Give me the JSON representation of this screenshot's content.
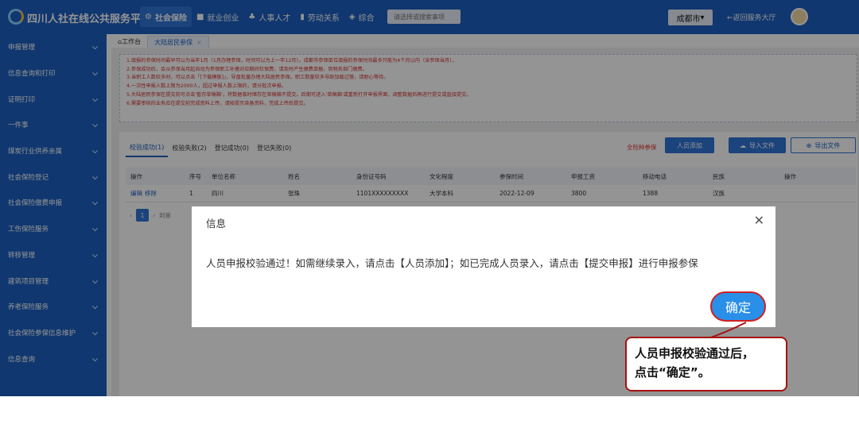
{
  "header": {
    "app_title": "四川人社在线公共服务平台",
    "nav": [
      {
        "icon": "shield-person-icon",
        "label": "社会保险",
        "glyph": "⚙"
      },
      {
        "icon": "briefcase-icon",
        "label": "就业创业",
        "glyph": "■"
      },
      {
        "icon": "people-icon",
        "label": "人事人才",
        "glyph": "♣"
      },
      {
        "icon": "document-icon",
        "label": "劳动关系",
        "glyph": "▮"
      },
      {
        "icon": "layers-icon",
        "label": "综合",
        "glyph": "◈"
      }
    ],
    "search_placeholder": "请选择或搜索事项",
    "city": "成都市",
    "city_caret": "▾",
    "back_label": "←返回服务大厅"
  },
  "sidebar": {
    "items": [
      {
        "label": "申报管理"
      },
      {
        "label": "信息查询和打印"
      },
      {
        "label": "证明打印"
      },
      {
        "label": "一件事"
      },
      {
        "label": "煤炭行业供养亲属"
      },
      {
        "label": "社会保险登记"
      },
      {
        "label": "社会保险缴费申报"
      },
      {
        "label": "工伤保险服务"
      },
      {
        "label": "转移管理"
      },
      {
        "label": "建筑项目管理"
      },
      {
        "label": "养老保险服务"
      },
      {
        "label": "社会保险参保信息维护"
      },
      {
        "label": "信息查询"
      }
    ]
  },
  "tabs": {
    "home_icon": "⌂",
    "home": "工作台",
    "active": "大陆居民参保",
    "close_glyph": "×"
  },
  "notice": {
    "lines": [
      "1.填报的参保时间最早可以为当年1月（1月办理参保，时间可以为上一年12月）。成都市参保单位填报的参保时间最多只能为4个月以内（含参保当月）。",
      "2.参保成功后，会从参保当月起自动为参保职工补缴对应期间社保费，请及时产生缴费单据，到税务部门缴费。",
      "3.当职工人数较多时，可以点击「[下载模板]」，导盘批量办理大陆居民参保。职工数量较多导致加载过慢，请耐心等待。",
      "4.一次性申报人数上限为2000人，超过申报人数上限的，请分批次申报。",
      "5.大陆居民参保在提交前可点击'暂存草稿箱'，将数据临时储存在草稿箱不提交。后期可进入'草稿箱'或重新打开申报界面，调整数据后再进行提交或直接提交。",
      "6.需要审核的业务应在提交前完成资料上传，请按提示准备资料，完成上传后提交。"
    ]
  },
  "panel": {
    "subtabs": [
      "校验成功(1)",
      "校验失败(2)",
      "登记成功(0)",
      "登记失败(0)"
    ],
    "all_insure_label": "全险种参保",
    "btn_add": "人员添加",
    "btn_import": "导入文件",
    "btn_import_icon": "☁",
    "btn_export": "导出文件",
    "btn_export_icon": "⊕",
    "table": {
      "headers": [
        "操作",
        "序号",
        "单位名称",
        "姓名",
        "身份证号码",
        "文化程度",
        "参保时间",
        "申报工资",
        "移动电话",
        "民族",
        "操作"
      ],
      "row": {
        "ops": [
          "编辑",
          "移除"
        ],
        "cells": [
          "1",
          "四川",
          "张珠",
          "1101XXXXXXXXX",
          "大学本科",
          "2022-12-09",
          "3800",
          "1388",
          "汉族",
          ""
        ]
      }
    },
    "pager": {
      "prev": "‹",
      "page": "1",
      "next": "›",
      "goto": "到第"
    }
  },
  "dialog": {
    "title": "信息",
    "close_glyph": "✕",
    "message": "人员申报校验通过！如需继续录入，请点击【人员添加】；如已完成人员录入，请点击【提交申报】进行申报参保",
    "confirm": "确定"
  },
  "callout": {
    "line1": "人员申报校验通过后，",
    "line2": "点击“确定”。"
  }
}
